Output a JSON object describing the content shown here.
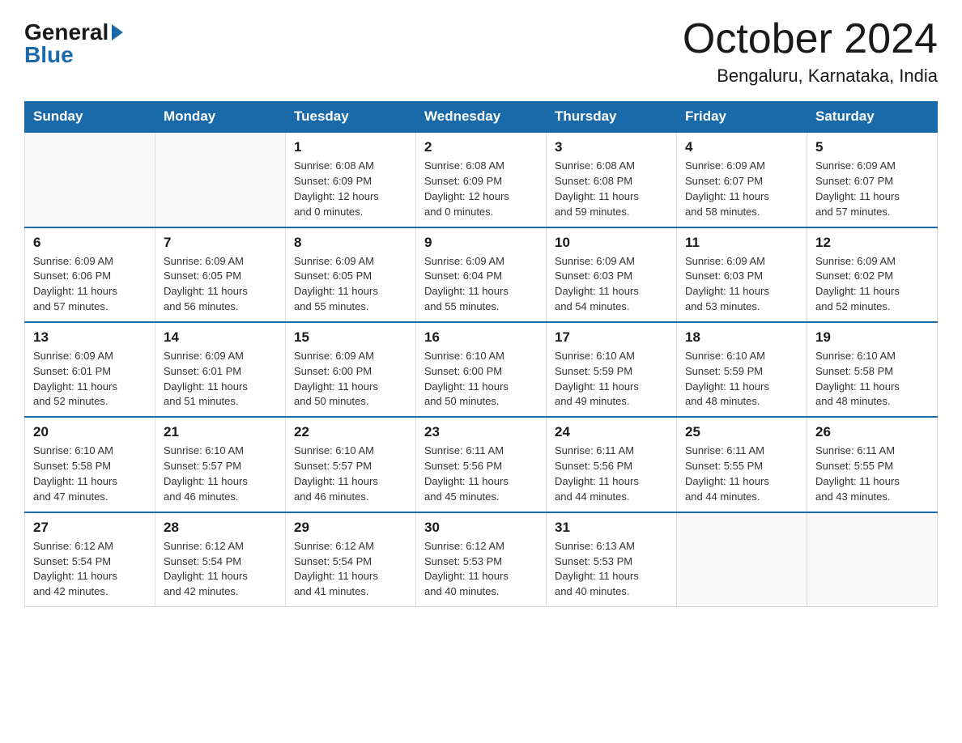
{
  "logo": {
    "general": "General",
    "blue": "Blue"
  },
  "header": {
    "month": "October 2024",
    "location": "Bengaluru, Karnataka, India"
  },
  "days_of_week": [
    "Sunday",
    "Monday",
    "Tuesday",
    "Wednesday",
    "Thursday",
    "Friday",
    "Saturday"
  ],
  "weeks": [
    [
      {
        "day": "",
        "info": ""
      },
      {
        "day": "",
        "info": ""
      },
      {
        "day": "1",
        "info": "Sunrise: 6:08 AM\nSunset: 6:09 PM\nDaylight: 12 hours\nand 0 minutes."
      },
      {
        "day": "2",
        "info": "Sunrise: 6:08 AM\nSunset: 6:09 PM\nDaylight: 12 hours\nand 0 minutes."
      },
      {
        "day": "3",
        "info": "Sunrise: 6:08 AM\nSunset: 6:08 PM\nDaylight: 11 hours\nand 59 minutes."
      },
      {
        "day": "4",
        "info": "Sunrise: 6:09 AM\nSunset: 6:07 PM\nDaylight: 11 hours\nand 58 minutes."
      },
      {
        "day": "5",
        "info": "Sunrise: 6:09 AM\nSunset: 6:07 PM\nDaylight: 11 hours\nand 57 minutes."
      }
    ],
    [
      {
        "day": "6",
        "info": "Sunrise: 6:09 AM\nSunset: 6:06 PM\nDaylight: 11 hours\nand 57 minutes."
      },
      {
        "day": "7",
        "info": "Sunrise: 6:09 AM\nSunset: 6:05 PM\nDaylight: 11 hours\nand 56 minutes."
      },
      {
        "day": "8",
        "info": "Sunrise: 6:09 AM\nSunset: 6:05 PM\nDaylight: 11 hours\nand 55 minutes."
      },
      {
        "day": "9",
        "info": "Sunrise: 6:09 AM\nSunset: 6:04 PM\nDaylight: 11 hours\nand 55 minutes."
      },
      {
        "day": "10",
        "info": "Sunrise: 6:09 AM\nSunset: 6:03 PM\nDaylight: 11 hours\nand 54 minutes."
      },
      {
        "day": "11",
        "info": "Sunrise: 6:09 AM\nSunset: 6:03 PM\nDaylight: 11 hours\nand 53 minutes."
      },
      {
        "day": "12",
        "info": "Sunrise: 6:09 AM\nSunset: 6:02 PM\nDaylight: 11 hours\nand 52 minutes."
      }
    ],
    [
      {
        "day": "13",
        "info": "Sunrise: 6:09 AM\nSunset: 6:01 PM\nDaylight: 11 hours\nand 52 minutes."
      },
      {
        "day": "14",
        "info": "Sunrise: 6:09 AM\nSunset: 6:01 PM\nDaylight: 11 hours\nand 51 minutes."
      },
      {
        "day": "15",
        "info": "Sunrise: 6:09 AM\nSunset: 6:00 PM\nDaylight: 11 hours\nand 50 minutes."
      },
      {
        "day": "16",
        "info": "Sunrise: 6:10 AM\nSunset: 6:00 PM\nDaylight: 11 hours\nand 50 minutes."
      },
      {
        "day": "17",
        "info": "Sunrise: 6:10 AM\nSunset: 5:59 PM\nDaylight: 11 hours\nand 49 minutes."
      },
      {
        "day": "18",
        "info": "Sunrise: 6:10 AM\nSunset: 5:59 PM\nDaylight: 11 hours\nand 48 minutes."
      },
      {
        "day": "19",
        "info": "Sunrise: 6:10 AM\nSunset: 5:58 PM\nDaylight: 11 hours\nand 48 minutes."
      }
    ],
    [
      {
        "day": "20",
        "info": "Sunrise: 6:10 AM\nSunset: 5:58 PM\nDaylight: 11 hours\nand 47 minutes."
      },
      {
        "day": "21",
        "info": "Sunrise: 6:10 AM\nSunset: 5:57 PM\nDaylight: 11 hours\nand 46 minutes."
      },
      {
        "day": "22",
        "info": "Sunrise: 6:10 AM\nSunset: 5:57 PM\nDaylight: 11 hours\nand 46 minutes."
      },
      {
        "day": "23",
        "info": "Sunrise: 6:11 AM\nSunset: 5:56 PM\nDaylight: 11 hours\nand 45 minutes."
      },
      {
        "day": "24",
        "info": "Sunrise: 6:11 AM\nSunset: 5:56 PM\nDaylight: 11 hours\nand 44 minutes."
      },
      {
        "day": "25",
        "info": "Sunrise: 6:11 AM\nSunset: 5:55 PM\nDaylight: 11 hours\nand 44 minutes."
      },
      {
        "day": "26",
        "info": "Sunrise: 6:11 AM\nSunset: 5:55 PM\nDaylight: 11 hours\nand 43 minutes."
      }
    ],
    [
      {
        "day": "27",
        "info": "Sunrise: 6:12 AM\nSunset: 5:54 PM\nDaylight: 11 hours\nand 42 minutes."
      },
      {
        "day": "28",
        "info": "Sunrise: 6:12 AM\nSunset: 5:54 PM\nDaylight: 11 hours\nand 42 minutes."
      },
      {
        "day": "29",
        "info": "Sunrise: 6:12 AM\nSunset: 5:54 PM\nDaylight: 11 hours\nand 41 minutes."
      },
      {
        "day": "30",
        "info": "Sunrise: 6:12 AM\nSunset: 5:53 PM\nDaylight: 11 hours\nand 40 minutes."
      },
      {
        "day": "31",
        "info": "Sunrise: 6:13 AM\nSunset: 5:53 PM\nDaylight: 11 hours\nand 40 minutes."
      },
      {
        "day": "",
        "info": ""
      },
      {
        "day": "",
        "info": ""
      }
    ]
  ]
}
